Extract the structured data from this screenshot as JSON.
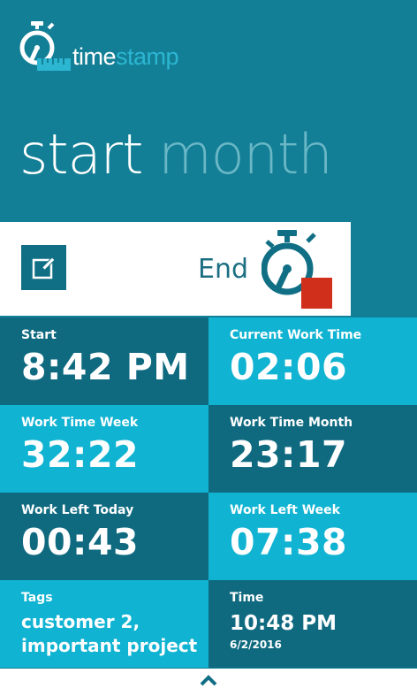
{
  "app": {
    "logo_time": "time",
    "logo_stamp": "stamp",
    "logo_icon": "stopwatch-ruler-icon"
  },
  "pivot": {
    "active": "start",
    "inactive": "month"
  },
  "actions": {
    "edit_icon": "edit-icon",
    "end_label": "End",
    "end_icon": "stopwatch-stop-icon"
  },
  "tiles": {
    "start": {
      "label": "Start",
      "value": "8:42 PM"
    },
    "current_work_time": {
      "label": "Current Work Time",
      "value": "02:06"
    },
    "work_time_week": {
      "label": "Work Time Week",
      "value": "32:22"
    },
    "work_time_month": {
      "label": "Work Time Month",
      "value": "23:17"
    },
    "work_left_today": {
      "label": "Work Left Today",
      "value": "00:43"
    },
    "work_left_week": {
      "label": "Work Left Week",
      "value": "07:38"
    },
    "tags": {
      "label": "Tags",
      "line1": "customer 2,",
      "line2": "important project"
    },
    "time": {
      "label": "Time",
      "value": "10:48 PM",
      "date": "6/2/2016"
    }
  },
  "bottom": {
    "expand_icon": "chevron-up-icon"
  },
  "colors": {
    "background": "#137f96",
    "tile_dark": "#0f6a80",
    "tile_light": "#10b3d2",
    "accent_stamp": "#2cb6d2",
    "stop_red": "#d0301b"
  }
}
